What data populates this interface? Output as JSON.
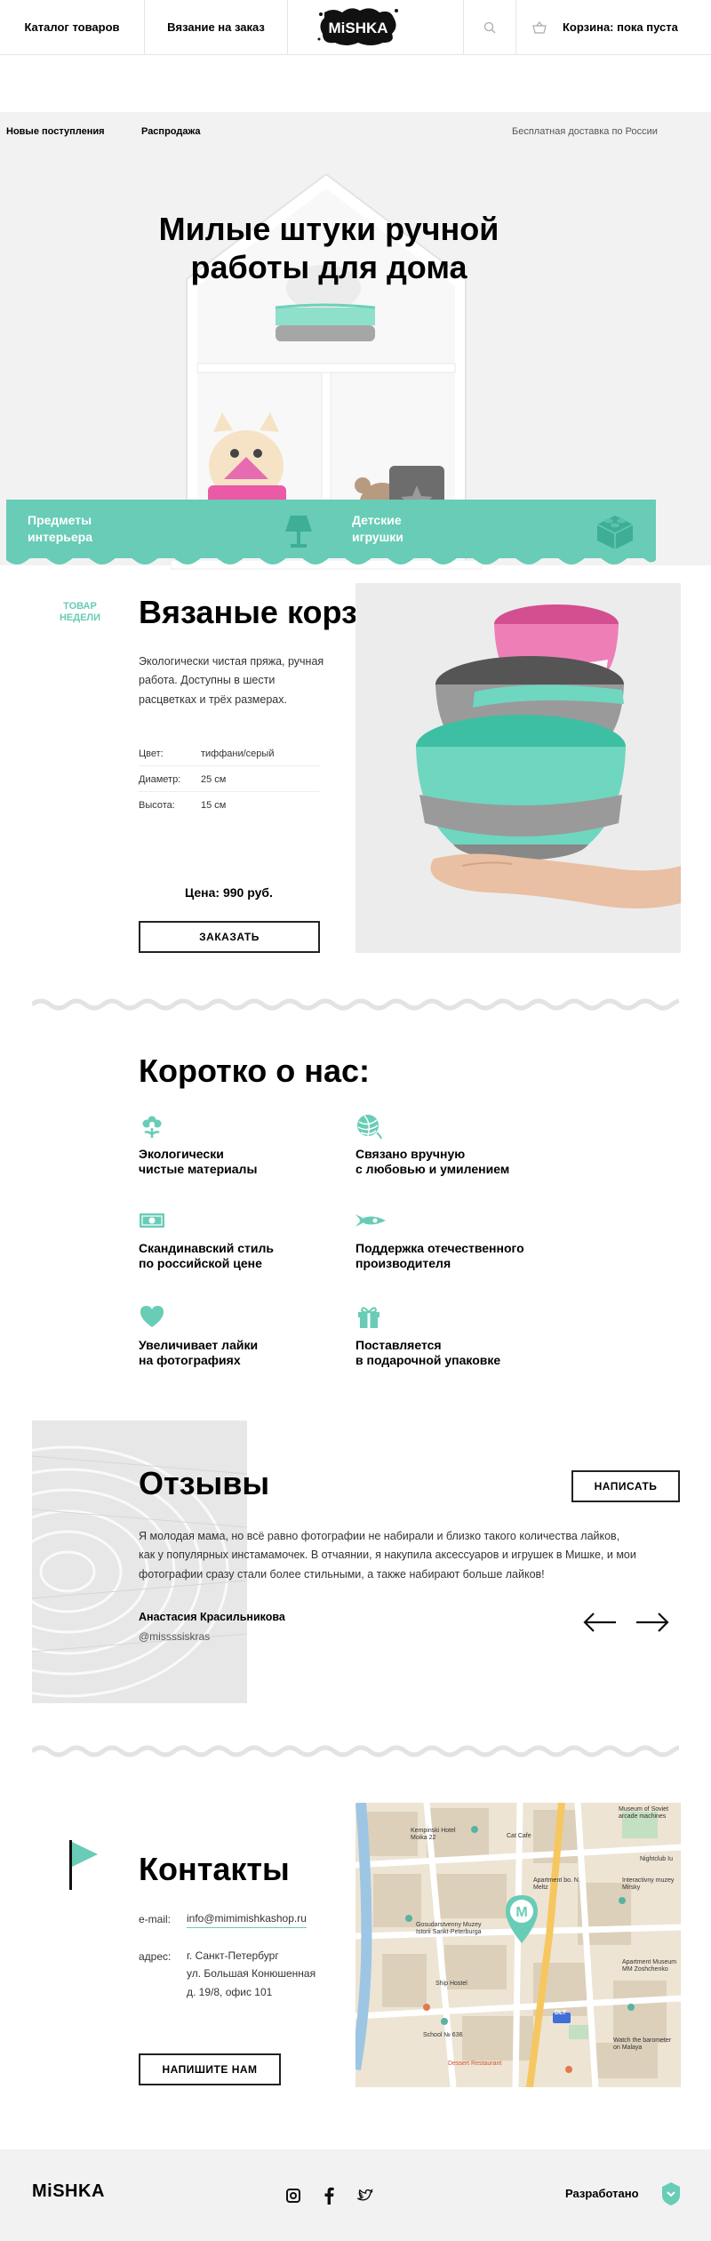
{
  "header": {
    "nav": [
      "Каталог товаров",
      "Вязание на заказ"
    ],
    "logo": "MiSHKA",
    "search_icon": "search-icon",
    "cart_icon": "basket-icon",
    "cart_label": "Корзина: пока пуста"
  },
  "hero": {
    "subnav": [
      "Новые поступления",
      "Распродажа"
    ],
    "delivery": "Бесплатная доставка по России",
    "title": "Милые штуки ручной работы для дома",
    "promo": [
      {
        "line1": "Предметы",
        "line2": "интерьера",
        "icon": "lamp-icon"
      },
      {
        "line1": "Детские",
        "line2": "игрушки",
        "icon": "lego-brick-icon"
      }
    ]
  },
  "product": {
    "badge_line1": "Товар",
    "badge_line2": "недели",
    "title": "Вязаные корзинки",
    "description": "Экологически чистая пряжа, ручная работа. Доступны в шести расцветках и трёх размерах.",
    "specs": [
      {
        "key": "Цвет:",
        "value": "тиффани/серый"
      },
      {
        "key": "Диаметр:",
        "value": "25 см"
      },
      {
        "key": "Высота:",
        "value": "15 см"
      }
    ],
    "price": "Цена: 990 руб.",
    "order_button": "Заказать"
  },
  "about": {
    "title": "Коротко о нас:",
    "features": [
      {
        "line1": "Экологически",
        "line2": "чистые материалы",
        "icon": "flower-icon"
      },
      {
        "line1": "Связано вручную",
        "line2": "с любовью и умилением",
        "icon": "yarn-ball-icon"
      },
      {
        "line1": "Скандинавский стиль",
        "line2": "по российской цене",
        "icon": "banknote-icon"
      },
      {
        "line1": "Поддержка отечественного",
        "line2": "производителя",
        "icon": "rocket-icon"
      },
      {
        "line1": "Увеличивает лайки",
        "line2": "на фотографиях",
        "icon": "heart-icon"
      },
      {
        "line1": "Поставляется",
        "line2": "в подарочной упаковке",
        "icon": "gift-icon"
      }
    ]
  },
  "reviews": {
    "title": "Отзывы",
    "write_button": "Написать",
    "text": "Я молодая мама, но всё равно фотографии не набирали и близко такого количества лайков, как у популярных инстамамочек. В отчаянии, я накупила аксессуаров и игрушек в Мишке, и мои фотографии сразу стали более стильными, а также набирают больше лайков!",
    "author": "Анастасия Красильникова",
    "handle": "@missssiskras",
    "prev_icon": "arrow-left-icon",
    "next_icon": "arrow-right-icon"
  },
  "contacts": {
    "title": "Контакты",
    "email_label": "e-mail:",
    "email": "info@mimimishkashop.ru",
    "address_label": "адрес:",
    "address_lines": [
      "г. Санкт-Петербург",
      "ул. Большая Конюшенная",
      "д. 19/8, офис 101"
    ],
    "write_button": "Напишите нам",
    "map_marker": "M",
    "map_labels": [
      "Museum of Soviet arcade machines",
      "Kempinski Hotel Moika 22",
      "Apartment bo. N. Meltz",
      "Cat Cafe",
      "Interactivny muzey Mirsky",
      "Nightclub Iu",
      "Apartment Museum MM Zoshchenko",
      "Watch the barometer on Malaya",
      "Gosudarstvenny Muzey Istorii Sankt-Peterburga",
      "Dessert Restaurant",
      "Ship Hostel",
      "School № 636",
      "DLT"
    ]
  },
  "footer": {
    "logo": "MiSHKA",
    "social_icons": [
      "instagram-icon",
      "facebook-icon",
      "twitter-icon"
    ],
    "developed_by": "Разработано",
    "dev_logo": "htmlacademy-icon"
  },
  "colors": {
    "accent": "#68ccb6",
    "dark": "#222222",
    "light_bg": "#f2f2f2"
  }
}
